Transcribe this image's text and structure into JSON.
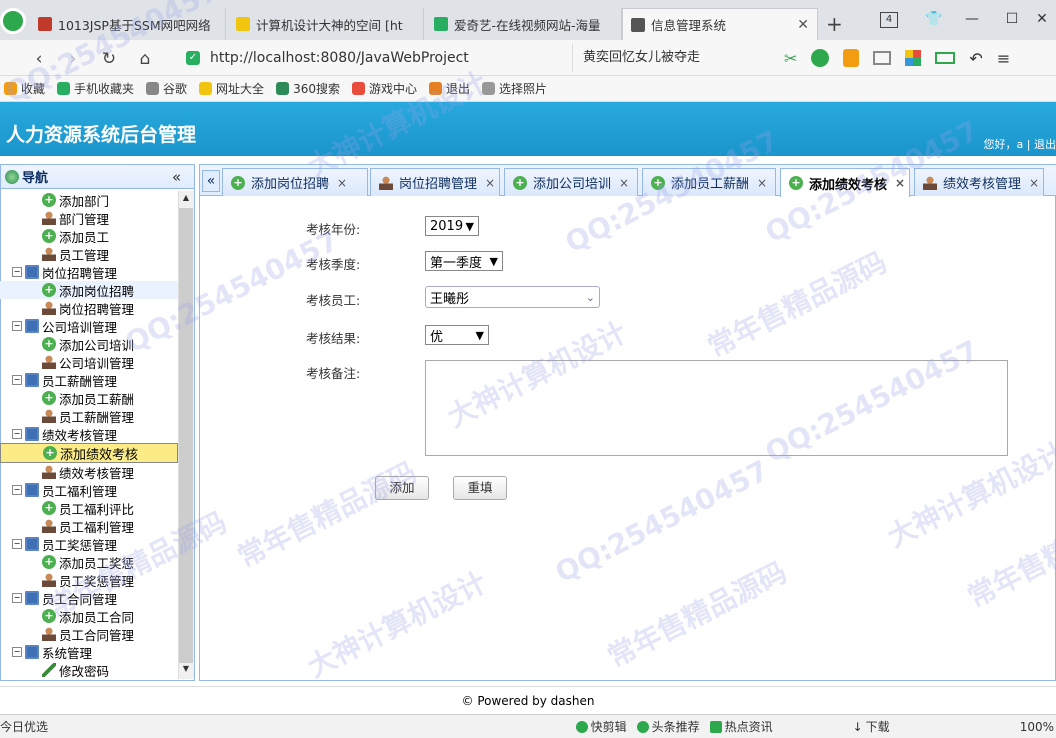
{
  "browser": {
    "tabs": [
      {
        "title": "1013JSP基于SSM网吧网络",
        "color": "#c0392b"
      },
      {
        "title": "计算机设计大神的空间 [ht",
        "color": "#f1c40f"
      },
      {
        "title": "爱奇艺-在线视频网站-海量",
        "color": "#27ae60"
      },
      {
        "title": "信息管理系统",
        "color": "#555555"
      }
    ],
    "new_tab": "+",
    "tab_count": "4",
    "url": "http://localhost:8080/JavaWebProject",
    "search_suggest": "黄奕回忆女儿被夺走",
    "bookmarks": [
      "收藏",
      "手机收藏夹",
      "谷歌",
      "网址大全",
      "360搜索",
      "游戏中心",
      "退出",
      "选择照片"
    ]
  },
  "app": {
    "title": "人力资源系统后台管理",
    "greeting": "您好，a | 退出"
  },
  "sidebar": {
    "title": "导航",
    "items": [
      {
        "label": "添加部门",
        "level": "child",
        "icon": "add"
      },
      {
        "label": "部门管理",
        "level": "child",
        "icon": "user"
      },
      {
        "label": "添加员工",
        "level": "child",
        "icon": "add"
      },
      {
        "label": "员工管理",
        "level": "child",
        "icon": "user"
      },
      {
        "label": "岗位招聘管理",
        "level": "parent",
        "icon": "monitor"
      },
      {
        "label": "添加岗位招聘",
        "level": "child",
        "icon": "add",
        "state": "hover"
      },
      {
        "label": "岗位招聘管理",
        "level": "child",
        "icon": "user"
      },
      {
        "label": "公司培训管理",
        "level": "parent",
        "icon": "monitor"
      },
      {
        "label": "添加公司培训",
        "level": "child",
        "icon": "add"
      },
      {
        "label": "公司培训管理",
        "level": "child",
        "icon": "user"
      },
      {
        "label": "员工薪酬管理",
        "level": "parent",
        "icon": "monitor"
      },
      {
        "label": "添加员工薪酬",
        "level": "child",
        "icon": "add"
      },
      {
        "label": "员工薪酬管理",
        "level": "child",
        "icon": "user"
      },
      {
        "label": "绩效考核管理",
        "level": "parent",
        "icon": "monitor"
      },
      {
        "label": "添加绩效考核",
        "level": "child",
        "icon": "add",
        "state": "selected"
      },
      {
        "label": "绩效考核管理",
        "level": "child",
        "icon": "user"
      },
      {
        "label": "员工福利管理",
        "level": "parent",
        "icon": "monitor"
      },
      {
        "label": "员工福利评比",
        "level": "child",
        "icon": "add"
      },
      {
        "label": "员工福利管理",
        "level": "child",
        "icon": "user"
      },
      {
        "label": "员工奖惩管理",
        "level": "parent",
        "icon": "monitor"
      },
      {
        "label": "添加员工奖惩",
        "level": "child",
        "icon": "add"
      },
      {
        "label": "员工奖惩管理",
        "level": "child",
        "icon": "user"
      },
      {
        "label": "员工合同管理",
        "level": "parent",
        "icon": "monitor"
      },
      {
        "label": "添加员工合同",
        "level": "child",
        "icon": "add"
      },
      {
        "label": "员工合同管理",
        "level": "child",
        "icon": "user"
      },
      {
        "label": "系统管理",
        "level": "parent",
        "icon": "monitor"
      },
      {
        "label": "修改密码",
        "level": "child",
        "icon": "pen"
      }
    ]
  },
  "main_tabs": [
    {
      "label": "添加岗位招聘",
      "icon": "add"
    },
    {
      "label": "岗位招聘管理",
      "icon": "user"
    },
    {
      "label": "添加公司培训",
      "icon": "add"
    },
    {
      "label": "添加员工薪酬",
      "icon": "add"
    },
    {
      "label": "添加绩效考核",
      "icon": "add",
      "active": true
    },
    {
      "label": "绩效考核管理",
      "icon": "user"
    }
  ],
  "form": {
    "year_label": "考核年份:",
    "year_value": "2019",
    "quarter_label": "考核季度:",
    "quarter_value": "第一季度",
    "employee_label": "考核员工:",
    "employee_value": "王曦彤",
    "result_label": "考核结果:",
    "result_value": "优",
    "remark_label": "考核备注:",
    "add_button": "添加",
    "reset_button": "重填"
  },
  "footer": "© Powered by dashen",
  "statusbar": [
    "今日优选",
    "快剪辑",
    "头条推荐",
    "热点资讯",
    "下载",
    "100%"
  ],
  "watermarks": [
    "QQ:254540457",
    "大神计算机设计",
    "常年售精品源码"
  ]
}
